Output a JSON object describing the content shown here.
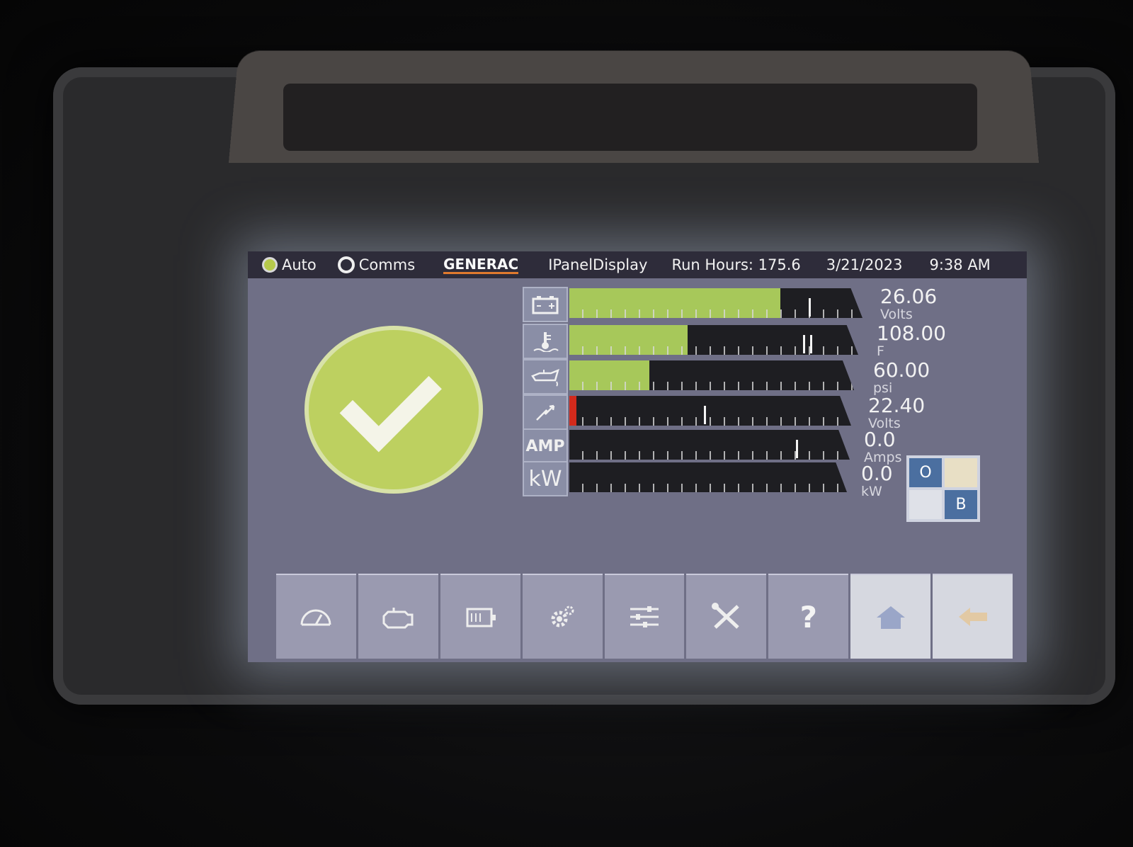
{
  "header": {
    "auto_label": "Auto",
    "comms_label": "Comms",
    "brand": "GENERAC",
    "panel_title": "IPanelDisplay",
    "run_hours": "Run Hours: 175.6",
    "date": "3/21/2023",
    "time": "9:38 AM"
  },
  "status": {
    "icon": "checkmark-icon",
    "color": "#bdd060"
  },
  "gauges": [
    {
      "icon": "battery-icon",
      "value": "26.06",
      "unit": "Volts",
      "fill": 0.72
    },
    {
      "icon": "coolant-temp-icon",
      "value": "108.00",
      "unit": "F",
      "fill": 0.41
    },
    {
      "icon": "oil-pressure-icon",
      "value": "60.00",
      "unit": "psi",
      "fill": 0.28
    },
    {
      "icon": "voltage-icon",
      "value": "22.40",
      "unit": "Volts",
      "fill": 0.02
    },
    {
      "icon_text": "AMP",
      "value": "0.0",
      "unit": "Amps",
      "fill": 0
    },
    {
      "icon_text": "kW",
      "value": "0.0",
      "unit": "kW",
      "fill": 0
    }
  ],
  "toggle": {
    "top_left": "O",
    "bottom_right": "B"
  },
  "nav": [
    "gauge-icon",
    "engine-icon",
    "generator-icon",
    "gear-icon",
    "sliders-icon",
    "tools-icon",
    "help-icon",
    "home-icon",
    "back-arrow-icon"
  ],
  "help_text": "?"
}
